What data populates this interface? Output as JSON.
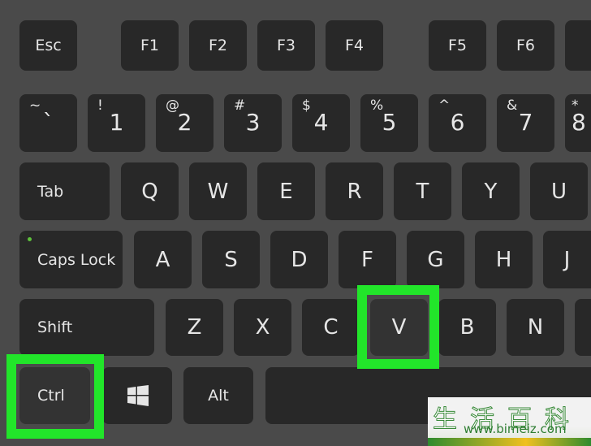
{
  "keyboard": {
    "function_row": [
      "Esc",
      "F1",
      "F2",
      "F3",
      "F4",
      "F5",
      "F6"
    ],
    "number_row": [
      {
        "shift": "~",
        "main": "`"
      },
      {
        "shift": "!",
        "main": "1"
      },
      {
        "shift": "@",
        "main": "2"
      },
      {
        "shift": "#",
        "main": "3"
      },
      {
        "shift": "$",
        "main": "4"
      },
      {
        "shift": "%",
        "main": "5"
      },
      {
        "shift": "^",
        "main": "6"
      },
      {
        "shift": "&",
        "main": "7"
      },
      {
        "shift": "*",
        "main": "8"
      }
    ],
    "qwerty_row": [
      "Tab",
      "Q",
      "W",
      "E",
      "R",
      "T",
      "Y",
      "U"
    ],
    "home_row": [
      "Caps Lock",
      "A",
      "S",
      "D",
      "F",
      "G",
      "H",
      "J"
    ],
    "bottom_letter_row": [
      "Shift",
      "Z",
      "X",
      "C",
      "V",
      "B",
      "N"
    ],
    "modifier_row": [
      "Ctrl",
      "",
      "Alt",
      ""
    ],
    "highlighted_keys": [
      "Ctrl",
      "V"
    ],
    "highlight_color": "#22e52a",
    "key_color": "#282828",
    "background_color": "#4a4a4a",
    "icons": {
      "windows_key": "windows-logo-icon",
      "caps_lock_indicator": "led-dot-icon"
    }
  },
  "watermark": {
    "chinese": "生活百科",
    "url": "www.bimeiz.com"
  }
}
